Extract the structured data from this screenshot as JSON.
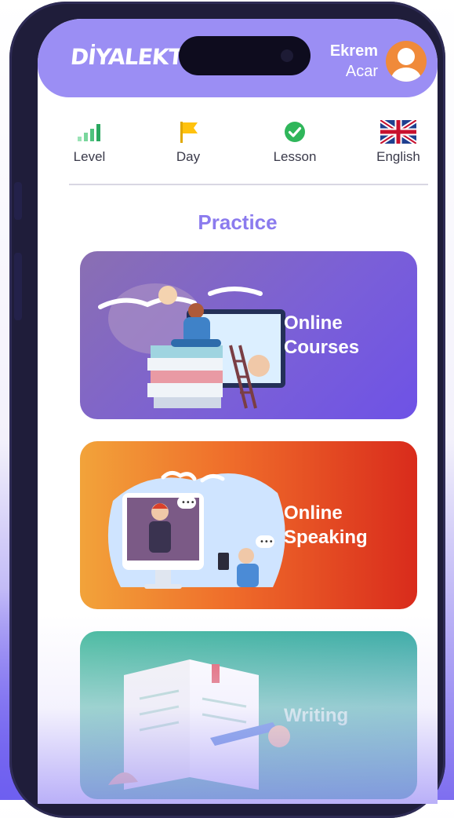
{
  "app": {
    "logo": "DİYALEKT"
  },
  "user": {
    "first_name": "Ekrem",
    "last_name": "Acar"
  },
  "stats": [
    {
      "label": "Level",
      "icon": "signal-bars-icon"
    },
    {
      "label": "Day",
      "icon": "flag-icon"
    },
    {
      "label": "Lesson",
      "icon": "check-circle-icon"
    },
    {
      "label": "English",
      "icon": "uk-flag-icon"
    }
  ],
  "practice": {
    "title": "Practice",
    "cards": [
      {
        "line1": "Online",
        "line2": "Courses"
      },
      {
        "line1": "Online",
        "line2": "Speaking"
      },
      {
        "line1": "Writing",
        "line2": ""
      }
    ]
  },
  "colors": {
    "header": "#9b8ef4",
    "accent": "#8b7bee",
    "courses_card": "#7a5fd8",
    "speaking_card": "#ef6c2a",
    "writing_card": "#3fb89a"
  }
}
